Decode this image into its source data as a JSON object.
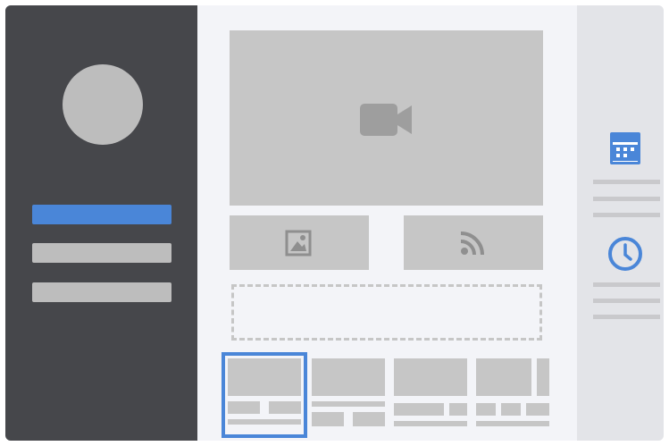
{
  "colors": {
    "accent": "#4a86d8",
    "sidebar": "#46474b",
    "placeholder": "#c6c6c6",
    "canvas": "#f3f4f8",
    "rightPanel": "#e3e4e8"
  },
  "icons": {
    "video": "video-camera-icon",
    "image": "image-icon",
    "feed": "rss-feed-icon",
    "calendar": "calendar-icon",
    "clock": "clock-icon"
  },
  "sidebar": {
    "active_index": 0,
    "item_count": 3
  },
  "layouts": {
    "selected_index": 0,
    "count": 4
  }
}
